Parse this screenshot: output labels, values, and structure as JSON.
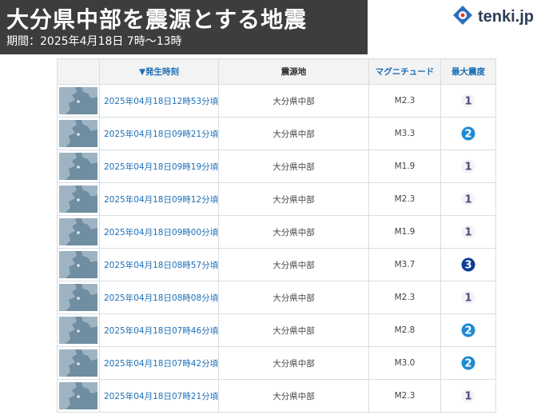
{
  "header": {
    "title": "大分県中部を震源とする地震",
    "subtitle": "期間：2025年4月18日 7時～13時"
  },
  "brand": {
    "name": "tenki.jp",
    "icon": "tenki-logo-icon",
    "color": "#2c3e57"
  },
  "table": {
    "columns": {
      "map": "",
      "time": "▼発生時刻",
      "epicenter": "震源地",
      "magnitude": "マグニチュード",
      "intensity": "最大震度"
    },
    "rows": [
      {
        "time": "2025年04月18日12時53分頃",
        "epicenter": "大分県中部",
        "magnitude": "M2.3",
        "intensity": "1"
      },
      {
        "time": "2025年04月18日09時21分頃",
        "epicenter": "大分県中部",
        "magnitude": "M3.3",
        "intensity": "2"
      },
      {
        "time": "2025年04月18日09時19分頃",
        "epicenter": "大分県中部",
        "magnitude": "M1.9",
        "intensity": "1"
      },
      {
        "time": "2025年04月18日09時12分頃",
        "epicenter": "大分県中部",
        "magnitude": "M2.3",
        "intensity": "1"
      },
      {
        "time": "2025年04月18日09時00分頃",
        "epicenter": "大分県中部",
        "magnitude": "M1.9",
        "intensity": "1"
      },
      {
        "time": "2025年04月18日08時57分頃",
        "epicenter": "大分県中部",
        "magnitude": "M3.7",
        "intensity": "3"
      },
      {
        "time": "2025年04月18日08時08分頃",
        "epicenter": "大分県中部",
        "magnitude": "M2.3",
        "intensity": "1"
      },
      {
        "time": "2025年04月18日07時46分頃",
        "epicenter": "大分県中部",
        "magnitude": "M2.8",
        "intensity": "2"
      },
      {
        "time": "2025年04月18日07時42分頃",
        "epicenter": "大分県中部",
        "magnitude": "M3.0",
        "intensity": "2"
      },
      {
        "time": "2025年04月18日07時21分頃",
        "epicenter": "大分県中部",
        "magnitude": "M2.3",
        "intensity": "1"
      }
    ]
  },
  "intensity_colors": {
    "1": "#f2f2f7",
    "2": "#1f8ad6",
    "3": "#0c3c96"
  }
}
